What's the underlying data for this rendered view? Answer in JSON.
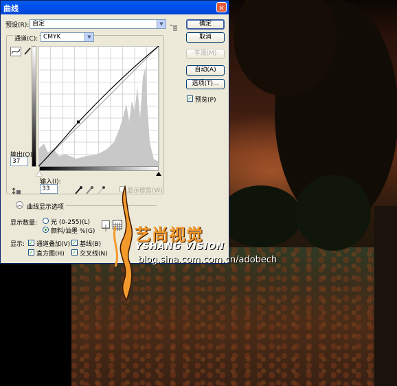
{
  "dialog": {
    "title": "曲线",
    "close_glyph": "×",
    "preset_label": "预设(R):",
    "preset_value": "自定",
    "preset_menu_icon": "list-icon",
    "channel_label": "通道(C):",
    "channel_value": "CMYK",
    "output_label": "输出(O):",
    "output_value": "37",
    "input_label": "输入(I):",
    "input_value": "33",
    "show_clipping_label": "显示修剪(W)",
    "curve_options_label": "曲线显示选项",
    "show_amount_label": "显示数量:",
    "radio_light": "光 (0-255)(L)",
    "radio_pigment": "颜料/油墨 %(G)",
    "display_label": "显示:",
    "chk_channel_overlay": "通道叠加(V)",
    "chk_baseline": "基线(B)",
    "chk_histogram": "直方图(H)",
    "chk_intersection": "交叉线(N)",
    "check_glyph": "✓"
  },
  "buttons": {
    "ok": "确定",
    "cancel": "取消",
    "smooth": "平滑(M)",
    "auto": "自动(A)",
    "options": "选项(T)..."
  },
  "preview": {
    "label": "预览(P)",
    "checked": true
  },
  "curve": {
    "control_point": {
      "input": 33,
      "output": 37
    }
  },
  "watermark": {
    "brand_cn": "艺尚视觉",
    "brand_en": "YSHANG VISION",
    "url": "blog.sina.com.com.cn/adobech"
  },
  "colors": {
    "titlebar": "#0050ee",
    "accent": "#f39a2c"
  }
}
